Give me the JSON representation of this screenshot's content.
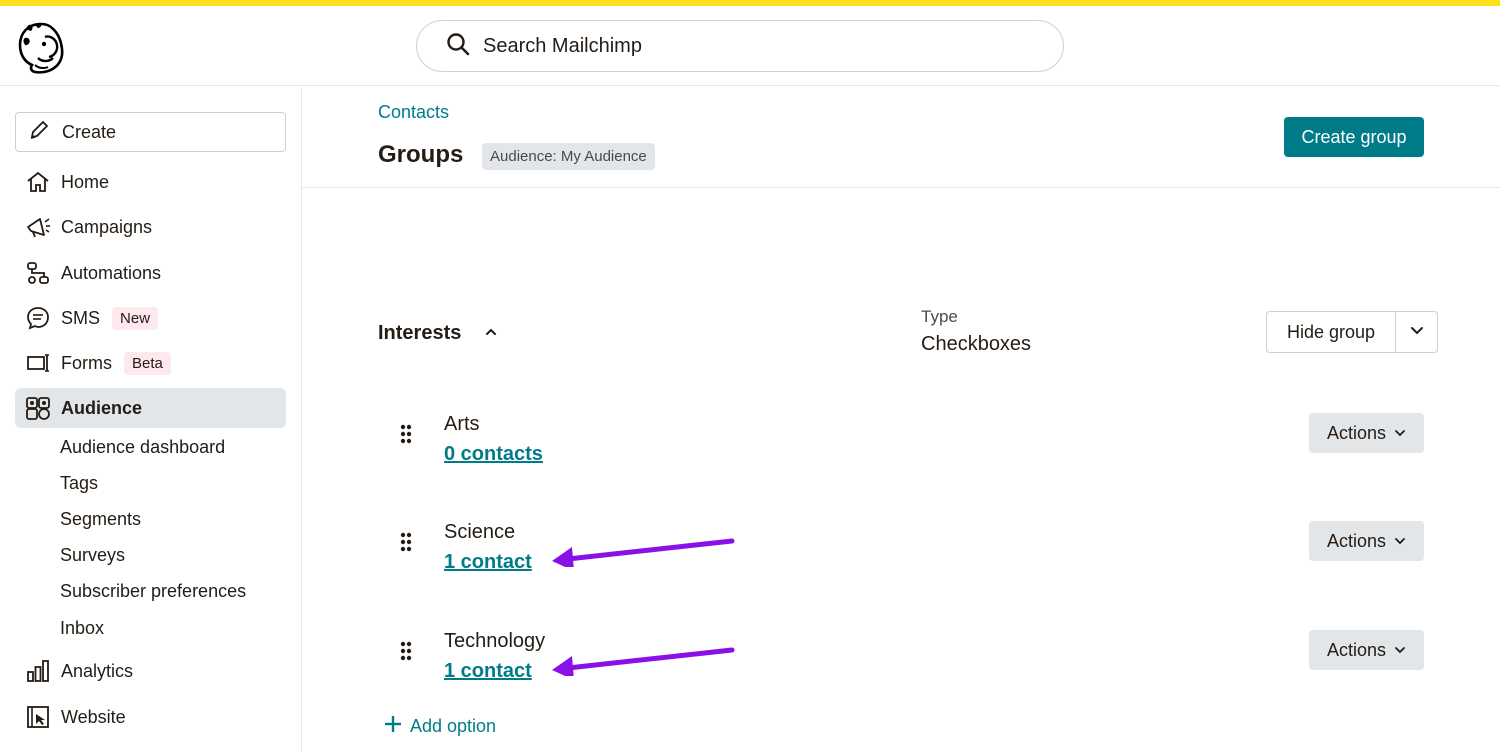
{
  "colors": {
    "accent": "#ffe01b",
    "primary": "#007c89",
    "annotation": "#8a10e8"
  },
  "search": {
    "placeholder": "Search Mailchimp",
    "icon": "search-icon"
  },
  "sidebar": {
    "create_label": "Create",
    "items": [
      {
        "label": "Home",
        "icon": "home-icon"
      },
      {
        "label": "Campaigns",
        "icon": "megaphone-icon"
      },
      {
        "label": "Automations",
        "icon": "automation-icon"
      },
      {
        "label": "SMS",
        "icon": "chat-icon",
        "badge": "New"
      },
      {
        "label": "Forms",
        "icon": "form-icon",
        "badge": "Beta"
      },
      {
        "label": "Audience",
        "icon": "audience-icon",
        "active": true
      },
      {
        "label": "Analytics",
        "icon": "bar-chart-icon"
      },
      {
        "label": "Website",
        "icon": "website-icon"
      }
    ],
    "audience_sub": [
      "Audience dashboard",
      "Tags",
      "Segments",
      "Surveys",
      "Subscriber preferences",
      "Inbox"
    ]
  },
  "header": {
    "breadcrumb": "Contacts",
    "title": "Groups",
    "audience_badge": "Audience: My Audience",
    "create_group": "Create group"
  },
  "group": {
    "name": "Interests",
    "type_label": "Type",
    "type_value": "Checkboxes",
    "hide_label": "Hide group",
    "options": [
      {
        "name": "Arts",
        "count": "0 contacts",
        "actions": "Actions"
      },
      {
        "name": "Science",
        "count": "1 contact",
        "actions": "Actions"
      },
      {
        "name": "Technology",
        "count": "1 contact",
        "actions": "Actions"
      }
    ],
    "add_option": "Add option"
  }
}
